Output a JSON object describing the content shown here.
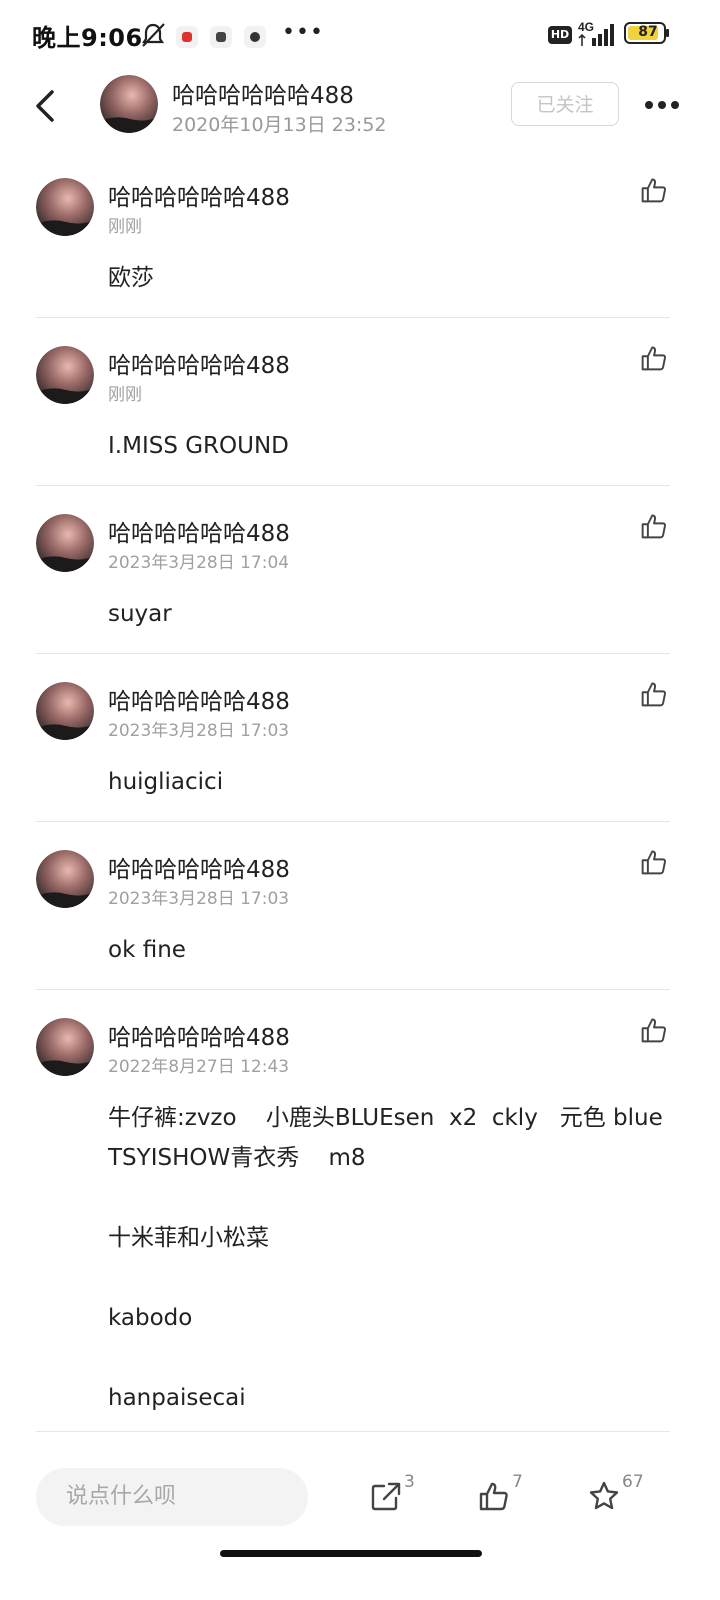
{
  "status_bar": {
    "time": "晚上9:06",
    "hd_label": "HD",
    "network_label": "4G",
    "battery_level": "87"
  },
  "header": {
    "username": "哈哈哈哈哈哈488",
    "timestamp": "2020年10月13日 23:52",
    "follow_label": "已关注"
  },
  "comments": [
    {
      "username": "哈哈哈哈哈哈488",
      "time": "刚刚",
      "text": "欧莎"
    },
    {
      "username": "哈哈哈哈哈哈488",
      "time": "刚刚",
      "text": "I.MISS GROUND"
    },
    {
      "username": "哈哈哈哈哈哈488",
      "time": "2023年3月28日 17:04",
      "text": "suyar"
    },
    {
      "username": "哈哈哈哈哈哈488",
      "time": "2023年3月28日 17:03",
      "text": "huigliacici"
    },
    {
      "username": "哈哈哈哈哈哈488",
      "time": "2023年3月28日 17:03",
      "text": "ok fine"
    },
    {
      "username": "哈哈哈哈哈哈488",
      "time": "2022年8月27日 12:43",
      "text": "牛仔裤:zvzo    小鹿头BLUEsen  x2  ckly   元色 blue   TSYISHOW青衣秀    m8\n\n十米菲和小松菜\n\nkabodo\n\nhanpaisecai"
    }
  ],
  "bottom_bar": {
    "input_placeholder": "说点什么呗",
    "share_count": "3",
    "like_count": "7",
    "star_count": "67"
  }
}
